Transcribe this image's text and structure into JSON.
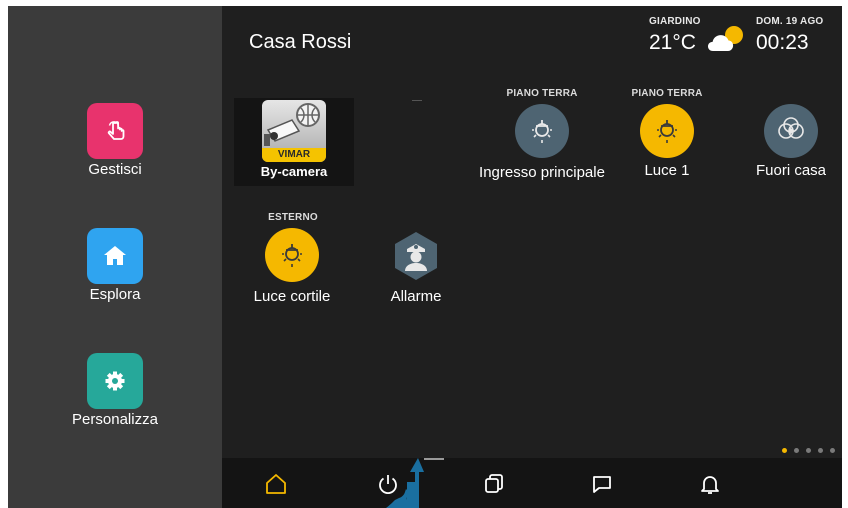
{
  "sidebar": {
    "items": [
      {
        "label": "Gestisci",
        "icon": "touch-hand-icon",
        "color": "#e8336d"
      },
      {
        "label": "Esplora",
        "icon": "home-icon",
        "color": "#2fa4f0"
      },
      {
        "label": "Personalizza",
        "icon": "gear-icon",
        "color": "#26a89a"
      }
    ]
  },
  "header": {
    "title": "Casa Rossi",
    "weather": {
      "location": "GIARDINO",
      "temperature": "21°C",
      "icon": "partly-cloudy-icon"
    },
    "datetime": {
      "date": "DOM. 19 AGO",
      "time": "00:23"
    }
  },
  "tiles": [
    {
      "caption": "",
      "label": "By-camera",
      "icon": "vimar-bycamera-app-icon",
      "badge": "VIMAR"
    },
    {
      "caption": "PIANO TERRA",
      "label": "Ingresso principale",
      "icon": "ceiling-lamp-icon",
      "state": "off"
    },
    {
      "caption": "PIANO TERRA",
      "label": "Luce 1",
      "icon": "ceiling-lamp-icon",
      "state": "on"
    },
    {
      "caption": "",
      "label": "Fuori casa",
      "icon": "scenario-icon",
      "state": "off"
    },
    {
      "caption": "ESTERNO",
      "label": "Luce cortile",
      "icon": "ceiling-lamp-icon",
      "state": "on"
    },
    {
      "caption": "",
      "label": "Allarme",
      "icon": "alarm-guard-icon",
      "state": "off"
    }
  ],
  "pagination": {
    "pages": 5,
    "current": 1
  },
  "taskbar": {
    "items": [
      "home-icon",
      "power-icon",
      "windows-icon",
      "chat-icon",
      "bell-icon"
    ],
    "active": "home-icon"
  },
  "colors": {
    "accent": "#f5b800",
    "light_on": "#f5b800",
    "device_off": "#4e6472",
    "sidebar_bg": "#3b3b3b",
    "main_bg": "#1f1f1f",
    "taskbar_bg": "#141414",
    "gesture_arrow": "#1a6fa0"
  }
}
